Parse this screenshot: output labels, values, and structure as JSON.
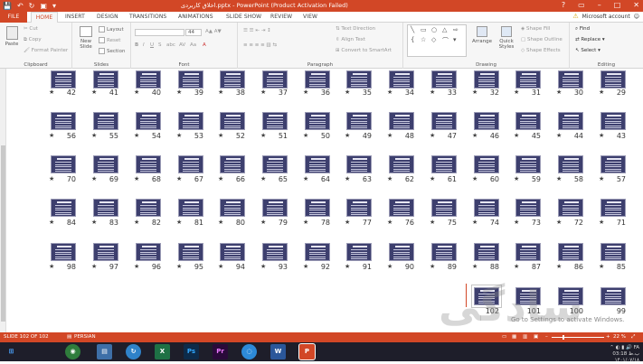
{
  "title_bar": {
    "title": "اخلاق کاربردی.pptx - PowerPoint (Product Activation Failed)",
    "qat": [
      "save-icon",
      "undo-icon",
      "redo-icon",
      "start-slideshow-icon",
      "customize-icon"
    ]
  },
  "tabs": [
    "FILE",
    "HOME",
    "INSERT",
    "DESIGN",
    "TRANSITIONS",
    "ANIMATIONS",
    "SLIDE SHOW",
    "REVIEW",
    "VIEW"
  ],
  "account": "Microsoft account",
  "ribbon": {
    "clipboard": {
      "paste": "Paste",
      "cut": "Cut",
      "copy": "Copy",
      "format_painter": "Format Painter",
      "label": "Clipboard"
    },
    "slides": {
      "new_slide": "New Slide",
      "layout": "Layout",
      "reset": "Reset",
      "section": "Section",
      "label": "Slides"
    },
    "font": {
      "size": "44",
      "label": "Font"
    },
    "paragraph": {
      "text_direction": "Text Direction",
      "align_text": "Align Text",
      "smartart": "Convert to SmartArt",
      "label": "Paragraph"
    },
    "drawing": {
      "arrange": "Arrange",
      "quick_styles": "Quick Styles",
      "shape_fill": "Shape Fill",
      "shape_outline": "Shape Outline",
      "shape_effects": "Shape Effects",
      "label": "Drawing"
    },
    "editing": {
      "find": "Find",
      "replace": "Replace",
      "select": "Select",
      "label": "Editing"
    }
  },
  "slides": {
    "row1": [
      "42",
      "41",
      "40",
      "39",
      "38",
      "37",
      "36",
      "35",
      "34",
      "33",
      "32",
      "31",
      "30",
      "29"
    ],
    "row2": [
      "56",
      "55",
      "54",
      "53",
      "52",
      "51",
      "50",
      "49",
      "48",
      "47",
      "46",
      "45",
      "44",
      "43"
    ],
    "row3": [
      "70",
      "69",
      "68",
      "67",
      "66",
      "65",
      "64",
      "63",
      "62",
      "61",
      "60",
      "59",
      "58",
      "57"
    ],
    "row4": [
      "84",
      "83",
      "82",
      "81",
      "80",
      "79",
      "78",
      "77",
      "76",
      "75",
      "74",
      "73",
      "72",
      "71"
    ],
    "row5": [
      "98",
      "97",
      "96",
      "95",
      "94",
      "93",
      "92",
      "91",
      "90",
      "89",
      "88",
      "87",
      "86",
      "85"
    ],
    "row6": [
      "102",
      "101",
      "100",
      "99"
    ]
  },
  "watermark": "سادگی",
  "activate_text": "Go to Settings to activate Windows.",
  "status": {
    "slide": "SLIDE 102 OF 102",
    "language": "PERSIAN",
    "zoom": "22 %"
  },
  "tray": {
    "lang": "FA",
    "time": "03:18 ب.ظ",
    "date": "۱۴۰۱/۰۷/۱۸"
  },
  "taskbar": [
    "start-icon",
    "chrome-icon",
    "explorer-icon",
    "sync-icon",
    "excel-icon",
    "photoshop-icon",
    "premiere-icon",
    "chat-icon",
    "word-icon",
    "powerpoint-icon"
  ]
}
